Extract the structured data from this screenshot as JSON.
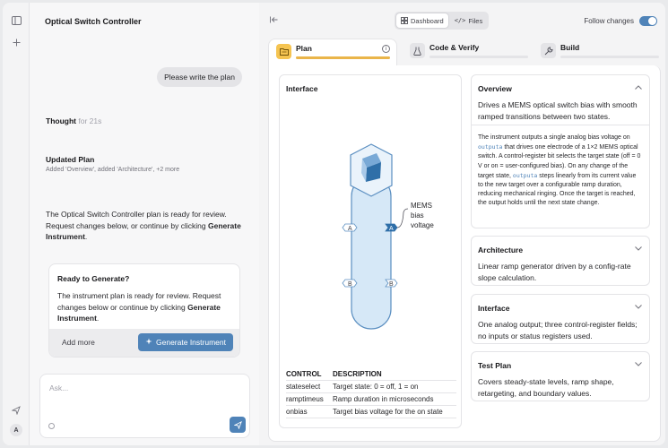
{
  "app": {
    "title": "Optical Switch Controller",
    "avatar_initial": "A"
  },
  "chat": {
    "user_message": "Please write the plan",
    "thought_label": "Thought",
    "thought_duration": "for 21s",
    "updated_plan_title": "Updated Plan",
    "updated_plan_detail": "Added 'Overview', added 'Architecture', +2 more",
    "ready_message_prefix": "The Optical Switch Controller plan is ready for review. Request changes below, or continue by clicking ",
    "ready_message_bold": "Generate Instrument",
    "ready_message_suffix": ".",
    "card": {
      "title": "Ready to Generate?",
      "body_prefix": "The instrument plan is ready for review. Request changes below or continue by clicking ",
      "body_bold": "Generate Instrument",
      "body_suffix": ".",
      "add_more": "Add more",
      "generate_button": "Generate Instrument"
    },
    "input_placeholder": "Ask..."
  },
  "header": {
    "view_options": [
      "Dashboard",
      "Files"
    ],
    "active_view": "Dashboard",
    "follow_changes_label": "Follow changes",
    "follow_changes_on": true
  },
  "tabs": [
    {
      "label": "Plan",
      "icon": "folder-icon",
      "progress": 1.0,
      "active": true
    },
    {
      "label": "Code & Verify",
      "icon": "flask-icon",
      "progress": 0,
      "active": false
    },
    {
      "label": "Build",
      "icon": "wrench-icon",
      "progress": 0,
      "active": false
    }
  ],
  "interface": {
    "title": "Interface",
    "output_label_lines": [
      "MEMS",
      "bias",
      "voltage"
    ],
    "port_a": "A",
    "port_b": "B",
    "table": {
      "headers": [
        "CONTROL",
        "DESCRIPTION"
      ],
      "rows": [
        [
          "stateselect",
          "Target state: 0 = off, 1 = on"
        ],
        [
          "ramptimeus",
          "Ramp duration in microseconds"
        ],
        [
          "onbias",
          "Target bias voltage for the on state"
        ]
      ]
    }
  },
  "sections": {
    "overview": {
      "title": "Overview",
      "summary": "Drives a MEMS optical switch bias with smooth ramped transitions between two states.",
      "detail": {
        "p1": "The instrument outputs a single analog bias voltage on ",
        "code1": "outputa",
        "p2": " that drives one electrode of a 1×2 MEMS optical switch. A control-register bit selects the target state (off = 0 V or on = user-configured bias). On any change of the target state, ",
        "code2": "outputa",
        "p3": " steps linearly from its current value to the new target over a configurable ramp duration, reducing mechanical ringing. Once the target is reached, the output holds until the next state change."
      }
    },
    "architecture": {
      "title": "Architecture",
      "summary": "Linear ramp generator driven by a config-rate slope calculation."
    },
    "interface": {
      "title": "Interface",
      "summary": "One analog output; three control-register fields; no inputs or status registers used."
    },
    "test_plan": {
      "title": "Test Plan",
      "summary": "Covers steady-state levels, ramp shape, retargeting, and boundary values."
    }
  },
  "colors": {
    "accent": "#4f83b8",
    "plan_tab": "#f5c451",
    "instrument_fill": "#d6e8f7",
    "instrument_stroke": "#5b8fc1"
  }
}
